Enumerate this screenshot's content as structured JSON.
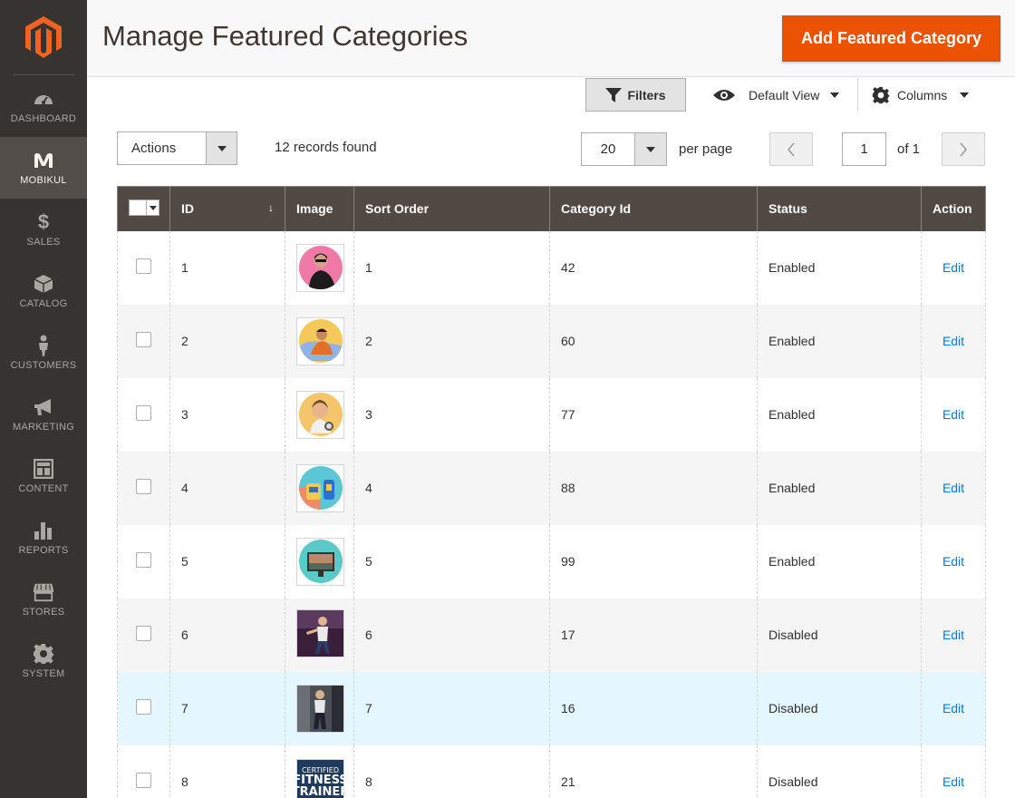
{
  "sidebar": {
    "items": [
      {
        "label": "DASHBOARD",
        "icon": "dashboard-icon"
      },
      {
        "label": "MOBIKUL",
        "icon": "mobikul-icon"
      },
      {
        "label": "SALES",
        "icon": "dollar-icon"
      },
      {
        "label": "CATALOG",
        "icon": "box-icon"
      },
      {
        "label": "CUSTOMERS",
        "icon": "person-icon"
      },
      {
        "label": "MARKETING",
        "icon": "megaphone-icon"
      },
      {
        "label": "CONTENT",
        "icon": "layout-icon"
      },
      {
        "label": "REPORTS",
        "icon": "bar-chart-icon"
      },
      {
        "label": "STORES",
        "icon": "store-icon"
      },
      {
        "label": "SYSTEM",
        "icon": "gear-icon"
      }
    ],
    "active": "MOBIKUL"
  },
  "header": {
    "title": "Manage Featured Categories",
    "add_button": "Add Featured Category"
  },
  "toolbar": {
    "filters": "Filters",
    "view": "Default View",
    "columns": "Columns",
    "actions": "Actions",
    "records": "12 records found",
    "per_page_value": "20",
    "per_page_label": "per page",
    "page_value": "1",
    "page_of": "of 1"
  },
  "grid": {
    "headers": [
      "ID",
      "Image",
      "Sort Order",
      "Category Id",
      "Status",
      "Action"
    ],
    "sort_indicator": "↓",
    "rows": [
      {
        "id": "1",
        "sort_order": "1",
        "category_id": "42",
        "status": "Enabled",
        "action": "Edit"
      },
      {
        "id": "2",
        "sort_order": "2",
        "category_id": "60",
        "status": "Enabled",
        "action": "Edit"
      },
      {
        "id": "3",
        "sort_order": "3",
        "category_id": "77",
        "status": "Enabled",
        "action": "Edit"
      },
      {
        "id": "4",
        "sort_order": "4",
        "category_id": "88",
        "status": "Enabled",
        "action": "Edit"
      },
      {
        "id": "5",
        "sort_order": "5",
        "category_id": "99",
        "status": "Enabled",
        "action": "Edit"
      },
      {
        "id": "6",
        "sort_order": "6",
        "category_id": "17",
        "status": "Disabled",
        "action": "Edit"
      },
      {
        "id": "7",
        "sort_order": "7",
        "category_id": "16",
        "status": "Disabled",
        "action": "Edit"
      },
      {
        "id": "8",
        "sort_order": "8",
        "category_id": "21",
        "status": "Disabled",
        "action": "Edit"
      }
    ],
    "thumb_text_row8": [
      "CERTIFIED",
      "FITNESS",
      "TRAINER"
    ]
  },
  "colors": {
    "sidebar_bg": "#373330",
    "accent": "#eb5202",
    "grid_header": "#514943",
    "link": "#007bdb"
  }
}
